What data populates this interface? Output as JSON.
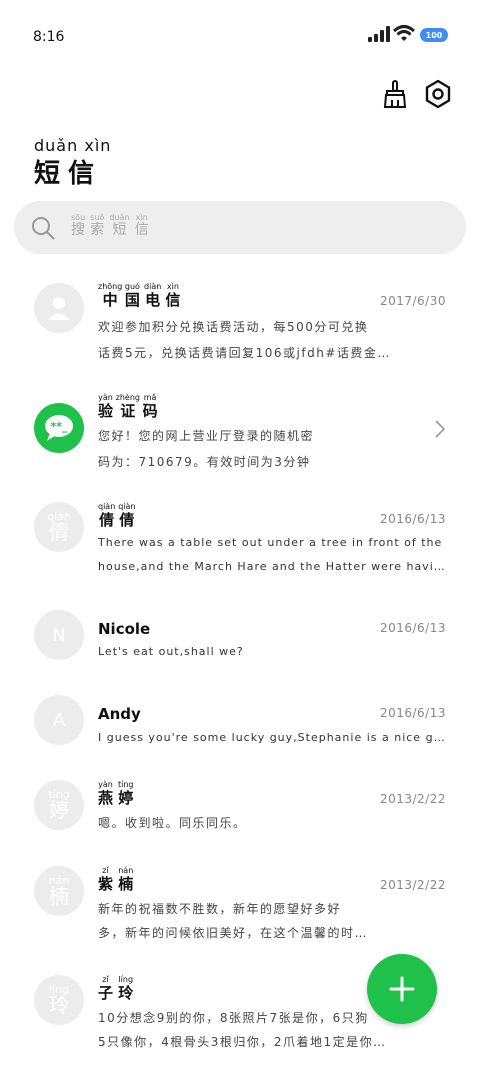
{
  "status": {
    "time": "8:16",
    "battery": "100"
  },
  "header": {
    "title_py": [
      "duǎn",
      "xìn"
    ],
    "title_hz": [
      "短",
      "信"
    ],
    "clear_icon": "broom-icon",
    "settings_icon": "gear-icon"
  },
  "search": {
    "placeholder_hz": [
      "搜",
      "索",
      "短",
      "信"
    ],
    "placeholder_py": [
      "sōu",
      "suǒ",
      "duǎn",
      "xìn"
    ]
  },
  "conversations": [
    {
      "avatar": "person-icon",
      "name_hz": [
        "中",
        "国",
        "电",
        "信"
      ],
      "name_py": [
        "zhōng",
        "guó",
        "diàn",
        "xìn"
      ],
      "date": "2017/6/30",
      "line1": "欢迎参加积分兑换话费活动，每500分可兑换",
      "line2": "话费5元，兑换话费请回复106或jfdh#话费金…"
    },
    {
      "avatar": "message-bubble-icon",
      "name_hz": [
        "验",
        "证",
        "码"
      ],
      "name_py": [
        "yàn",
        "zhèng",
        "mǎ"
      ],
      "line1": "您好！您的网上营业厅登录的随机密",
      "line2": "码为：710679。有效时间为3分钟"
    },
    {
      "avatar_py": "qiàn",
      "avatar_hz": "倩",
      "name_hz": [
        "倩",
        "倩"
      ],
      "name_py": [
        "qiàn",
        "qiàn"
      ],
      "date": "2016/6/13",
      "line1": "There was a table set out under a tree in front of the",
      "line2": "house,and the March Hare and the Hatter were having te…"
    },
    {
      "avatar_letter": "N",
      "name": "Nicole",
      "date": "2016/6/13",
      "line1": "Let's eat out,shall we?"
    },
    {
      "avatar_letter": "A",
      "name": "Andy",
      "date": "2016/6/13",
      "line1": "I guess you're some lucky guy,Stephanie is a nice girl."
    },
    {
      "avatar_py": "tíng",
      "avatar_hz": "婷",
      "name_hz": [
        "燕",
        "婷"
      ],
      "name_py": [
        "yàn",
        "tíng"
      ],
      "date": "2013/2/22",
      "line1": "嗯。收到啦。同乐同乐。"
    },
    {
      "avatar_py": "nán",
      "avatar_hz": "楠",
      "name_hz": [
        "紫",
        "楠"
      ],
      "name_py": [
        "zǐ",
        "nán"
      ],
      "date": "2013/2/22",
      "line1": "新年的祝福数不胜数，新年的愿望好多好",
      "line2": "多，新年的问候依旧美好，在这个温馨的时…"
    },
    {
      "avatar_py": "líng",
      "avatar_hz": "玲",
      "name_hz": [
        "子",
        "玲"
      ],
      "name_py": [
        "zǐ",
        "líng"
      ],
      "line1": "10分想念9别的你，8张照片7张是你，6只狗",
      "line2": "5只像你，4根骨头3根归你，2爪着地1定是你…"
    }
  ],
  "fab": {
    "icon": "plus-icon"
  }
}
